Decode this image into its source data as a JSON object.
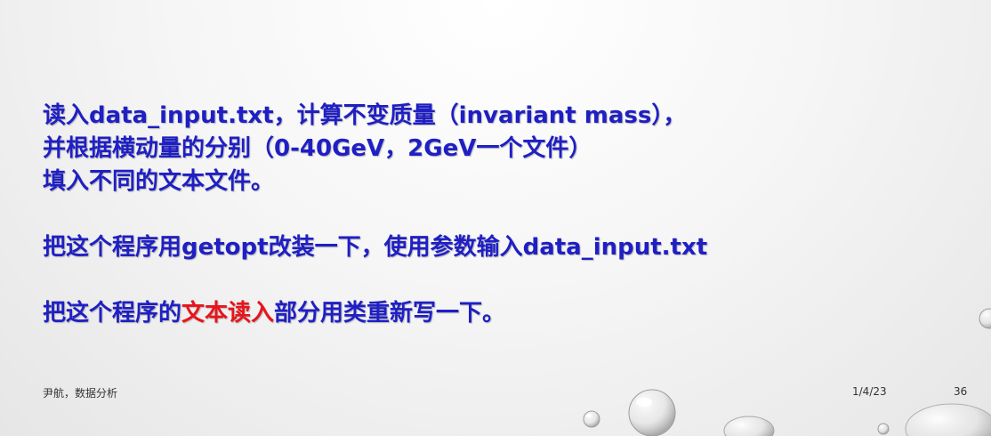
{
  "content": {
    "line1": "读入data_input.txt，计算不变质量（invariant mass），",
    "line2": "并根据横动量的分别（0-40GeV，2GeV一个文件）",
    "line3": "填入不同的文本文件。",
    "line4": "把这个程序用getopt改装一下，使用参数输入data_input.txt",
    "line5_prefix": "把这个程序的",
    "line5_highlight": "文本读入",
    "line5_suffix": "部分用类重新写一下。"
  },
  "footer": {
    "author": "尹航，数据分析",
    "date": "1/4/23",
    "page_number": "36"
  },
  "colors": {
    "text": "#1f1fc4",
    "highlight": "#e8141b"
  }
}
